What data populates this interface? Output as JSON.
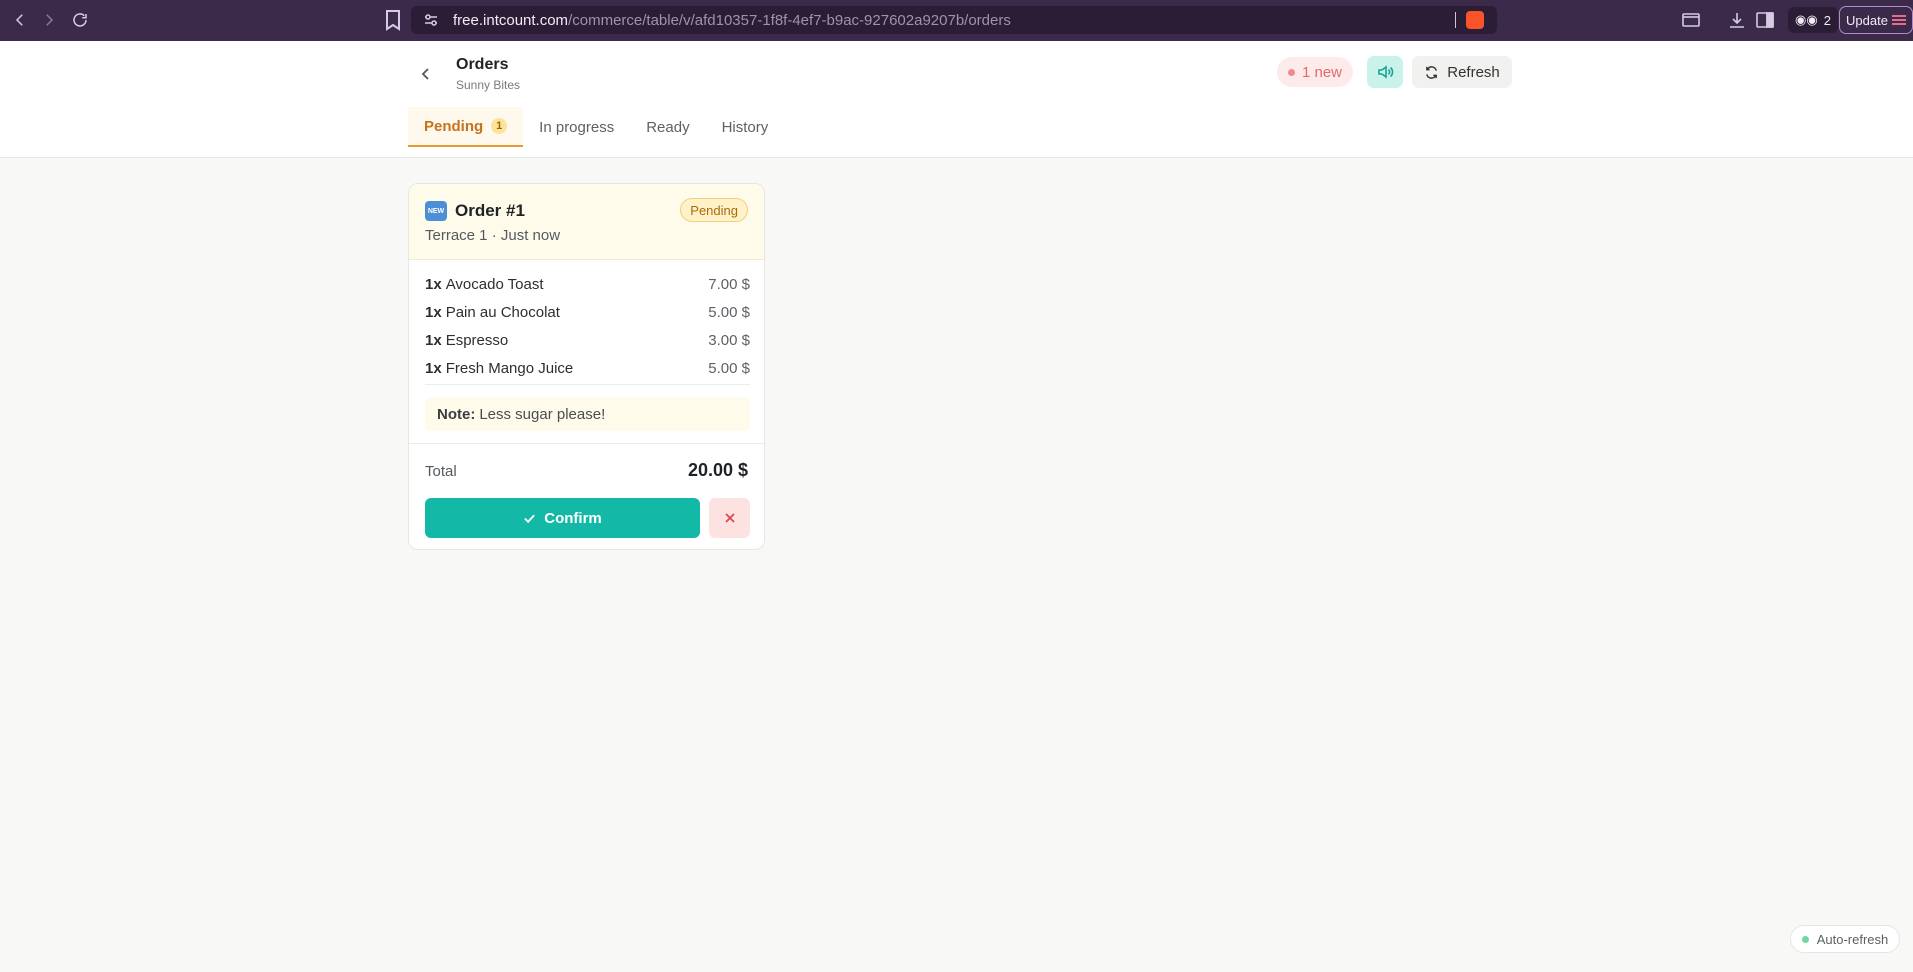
{
  "browser": {
    "url_host": "free.intcount.com",
    "url_path": "/commerce/table/v/afd10357-1f8f-4ef7-b9ac-927602a9207b/orders",
    "wallet_count": "2",
    "update_label": "Update"
  },
  "header": {
    "title": "Orders",
    "subtitle": "Sunny Bites",
    "new_badge": "1 new",
    "refresh_label": "Refresh"
  },
  "tabs": [
    {
      "label": "Pending",
      "count": "1",
      "active": true
    },
    {
      "label": "In progress"
    },
    {
      "label": "Ready"
    },
    {
      "label": "History"
    }
  ],
  "order": {
    "badge_icon": "NEW",
    "title": "Order #1",
    "meta": "Terrace 1 · Just now",
    "status": "Pending",
    "items": [
      {
        "qty": "1x",
        "name": "Avocado Toast",
        "price": "7.00 $"
      },
      {
        "qty": "1x",
        "name": "Pain au Chocolat",
        "price": "5.00 $"
      },
      {
        "qty": "1x",
        "name": "Espresso",
        "price": "3.00 $"
      },
      {
        "qty": "1x",
        "name": "Fresh Mango Juice",
        "price": "5.00 $"
      }
    ],
    "note_label": "Note:",
    "note_text": "Less sugar please!",
    "total_label": "Total",
    "total_value": "20.00 $",
    "confirm_label": "Confirm"
  },
  "footer": {
    "auto_refresh_label": "Auto-refresh"
  },
  "colors": {
    "accent": "#14b8a6",
    "pending_tab": "#c7731a",
    "chrome": "#3b2a4a"
  }
}
